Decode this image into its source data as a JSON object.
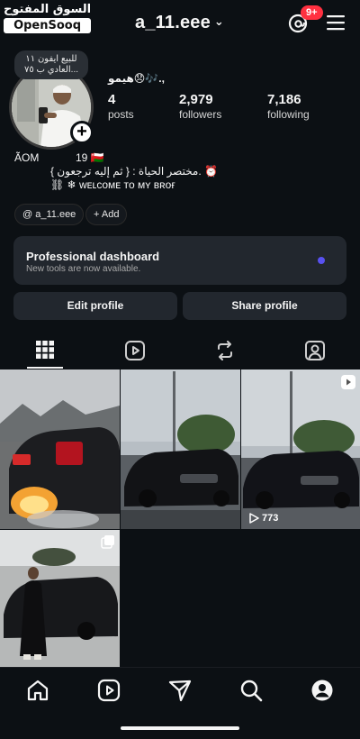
{
  "watermark": {
    "arabic": "السوق المفتوح",
    "brand": "OpenSooq"
  },
  "header": {
    "username": "a_11.eee",
    "notification_count": "9+"
  },
  "profile": {
    "note": "للبيع ايفون ١١ العادي ب ٧٥...",
    "display_name": "هيمو😞🎶.,",
    "stats": [
      {
        "value": "4",
        "label": "posts"
      },
      {
        "value": "2,979",
        "label": "followers"
      },
      {
        "value": "7,186",
        "label": "following"
      }
    ],
    "bio": {
      "country": "ÃOM",
      "age": "19 🇴🇲",
      "line2": "مختصر الحياة : { ثم إليه ترجعون }. ⏰",
      "line3": "⛓ ❄ ᴡᴇʟᴄᴏᴍᴇ ᴛᴏ ᴍʏ ʙʀᴏғ"
    },
    "chips": [
      {
        "label": "a_11.eee",
        "icon": "threads-icon"
      },
      {
        "label": "Add",
        "icon": "plus-icon"
      }
    ]
  },
  "professional_dashboard": {
    "title": "Professional dashboard",
    "subtitle": "New tools are now available.",
    "accent": "#5851f0"
  },
  "actions": {
    "edit": "Edit profile",
    "share": "Share profile"
  },
  "tabs": [
    {
      "name": "grid",
      "icon": "grid-icon",
      "active": true
    },
    {
      "name": "reels",
      "icon": "reels-icon",
      "active": false
    },
    {
      "name": "reposts",
      "icon": "repost-icon",
      "active": false
    },
    {
      "name": "tagged",
      "icon": "tagged-icon",
      "active": false
    }
  ],
  "posts": [
    {
      "type": "photo",
      "scene": "black sedan with tire burnout flames in rain"
    },
    {
      "type": "photo",
      "scene": "black sedan parked under cloudy sky"
    },
    {
      "type": "reel",
      "views": "773",
      "scene": "black sedan parked near trees"
    },
    {
      "type": "carousel",
      "scene": "man leaning on black sedan"
    }
  ],
  "bottom_nav": [
    "home-icon",
    "reels-icon",
    "send-icon",
    "search-icon",
    "profile-icon"
  ]
}
